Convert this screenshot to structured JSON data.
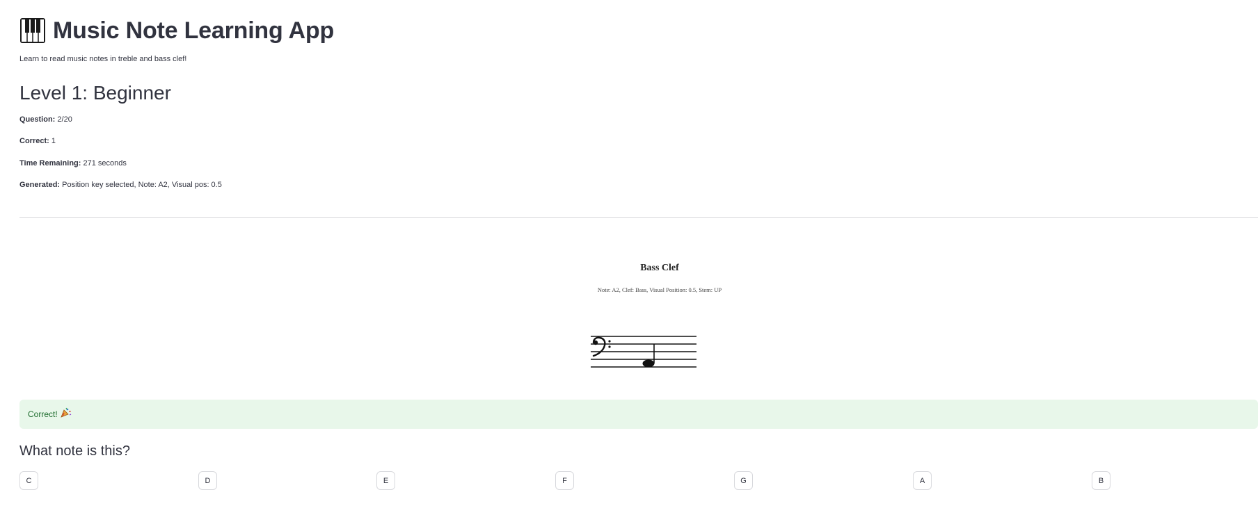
{
  "app": {
    "title": "Music Note Learning App",
    "subtitle": "Learn to read music notes in treble and bass clef!",
    "title_icon": "piano-keys-icon"
  },
  "level": {
    "heading": "Level 1: Beginner"
  },
  "stats": [
    {
      "label": "Question:",
      "value": "2/20"
    },
    {
      "label": "Correct:",
      "value": "1"
    },
    {
      "label": "Time Remaining:",
      "value": "271 seconds"
    },
    {
      "label": "Generated:",
      "value": "Position key selected, Note: A2, Visual pos: 0.5"
    }
  ],
  "staff": {
    "title": "Bass Clef",
    "info": "Note: A2, Clef: Bass, Visual Position: 0.5, Stem: UP",
    "clef_symbol": "𝄢",
    "note": "A2",
    "stem": "UP"
  },
  "feedback": {
    "text": "Correct!",
    "icon": "party-popper-icon",
    "color": "#1c6b2c",
    "background": "#e8f7ea"
  },
  "question": {
    "prompt": "What note is this?",
    "options": [
      "C",
      "D",
      "E",
      "F",
      "G",
      "A",
      "B"
    ]
  }
}
